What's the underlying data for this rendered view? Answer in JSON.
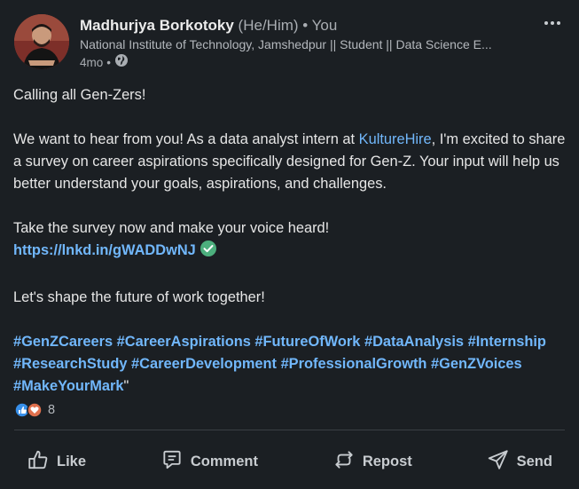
{
  "author": {
    "name": "Madhurjya Borkotoky",
    "pronouns": "(He/Him)",
    "you_label": "• You",
    "headline": "National Institute of Technology, Jamshedpur || Student || Data Science E...",
    "time": "4mo",
    "dot": "•",
    "visibility_icon": "globe-icon"
  },
  "post": {
    "line1": "Calling all Gen-Zers!",
    "para2_before": "We want to hear from you! As a data analyst intern at ",
    "mention": "KultureHire",
    "para2_after": ", I'm excited to share a survey on career aspirations specifically designed for Gen-Z. Your input will help us better understand your goals, aspirations, and challenges.",
    "para3": "Take the survey now and make your voice heard!",
    "url": "https://lnkd.in/gWADDwNJ",
    "para4": "Let's shape the future of work together!",
    "hashtags": [
      "#GenZCareers",
      "#CareerAspirations",
      "#FutureOfWork",
      "#DataAnalysis",
      "#Internship",
      "#ResearchStudy",
      "#CareerDevelopment",
      "#ProfessionalGrowth",
      "#GenZVoices",
      "#MakeYourMark"
    ],
    "trailing_quote": "\""
  },
  "reactions": {
    "count": "8",
    "icons": [
      "like-reaction-icon",
      "love-reaction-icon"
    ]
  },
  "actions": {
    "like": "Like",
    "comment": "Comment",
    "repost": "Repost",
    "send": "Send"
  },
  "colors": {
    "background": "#1b1f23",
    "link": "#71b7fb",
    "verified": "#4caf7d"
  }
}
